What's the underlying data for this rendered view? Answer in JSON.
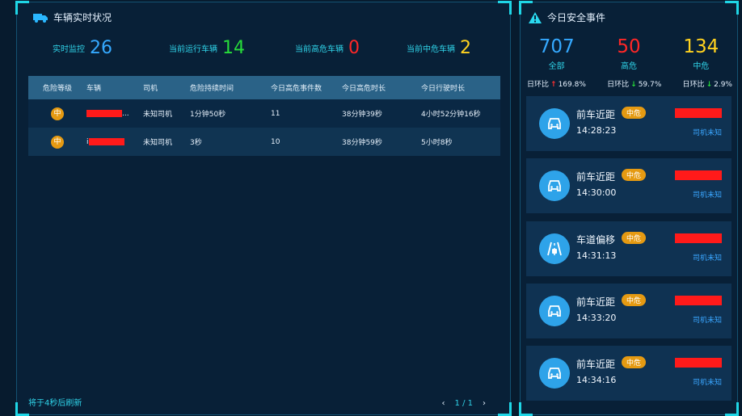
{
  "left_panel": {
    "title": "车辆实时状况",
    "stats": [
      {
        "label": "实时监控",
        "value": "26",
        "color": "#35a9ff"
      },
      {
        "label": "当前运行车辆",
        "value": "14",
        "color": "#27dc3a"
      },
      {
        "label": "当前高危车辆",
        "value": "0",
        "color": "#ff2727"
      },
      {
        "label": "当前中危车辆",
        "value": "2",
        "color": "#ffd21f"
      }
    ],
    "table": {
      "headers": [
        "危险等级",
        "车辆",
        "司机",
        "危险持续时间",
        "今日高危事件数",
        "今日高危时长",
        "今日行驶时长"
      ],
      "rows": [
        {
          "level": "中",
          "vehicle_suffix": "...",
          "driver": "未知司机",
          "duration": "1分钟50秒",
          "events": "11",
          "high_time": "38分钟39秒",
          "drive_time": "4小时52分钟16秒"
        },
        {
          "level": "中",
          "vehicle_suffix": "i",
          "driver": "未知司机",
          "duration": "3秒",
          "events": "10",
          "high_time": "38分钟59秒",
          "drive_time": "5小时8秒"
        }
      ]
    },
    "footer": "将于4秒后刷新",
    "pager": {
      "prev": "‹",
      "page": "1 / 1",
      "next": "›"
    }
  },
  "right_panel": {
    "title": "今日安全事件",
    "summary": [
      {
        "value": "707",
        "label": "全部",
        "color": "#35a9ff"
      },
      {
        "value": "50",
        "label": "高危",
        "color": "#ff2727"
      },
      {
        "value": "134",
        "label": "中危",
        "color": "#ffd21f"
      }
    ],
    "comparisons": [
      {
        "label": "日环比",
        "arrow": "↑",
        "arrow_color": "#ff3030",
        "value": "169.8%"
      },
      {
        "label": "日环比",
        "arrow": "↓",
        "arrow_color": "#27dc3a",
        "value": "59.7%"
      },
      {
        "label": "日环比",
        "arrow": "↓",
        "arrow_color": "#27dc3a",
        "value": "2.9%"
      }
    ],
    "events": [
      {
        "type": "前车近距",
        "level": "中危",
        "time": "14:28:23",
        "driver": "司机未知",
        "icon": "car-icon"
      },
      {
        "type": "前车近距",
        "level": "中危",
        "time": "14:30:00",
        "driver": "司机未知",
        "icon": "car-icon"
      },
      {
        "type": "车道偏移",
        "level": "中危",
        "time": "14:31:13",
        "driver": "司机未知",
        "icon": "lane-icon"
      },
      {
        "type": "前车近距",
        "level": "中危",
        "time": "14:33:20",
        "driver": "司机未知",
        "icon": "car-icon"
      },
      {
        "type": "前车近距",
        "level": "中危",
        "time": "14:34:16",
        "driver": "司机未知",
        "icon": "car-icon"
      }
    ]
  }
}
